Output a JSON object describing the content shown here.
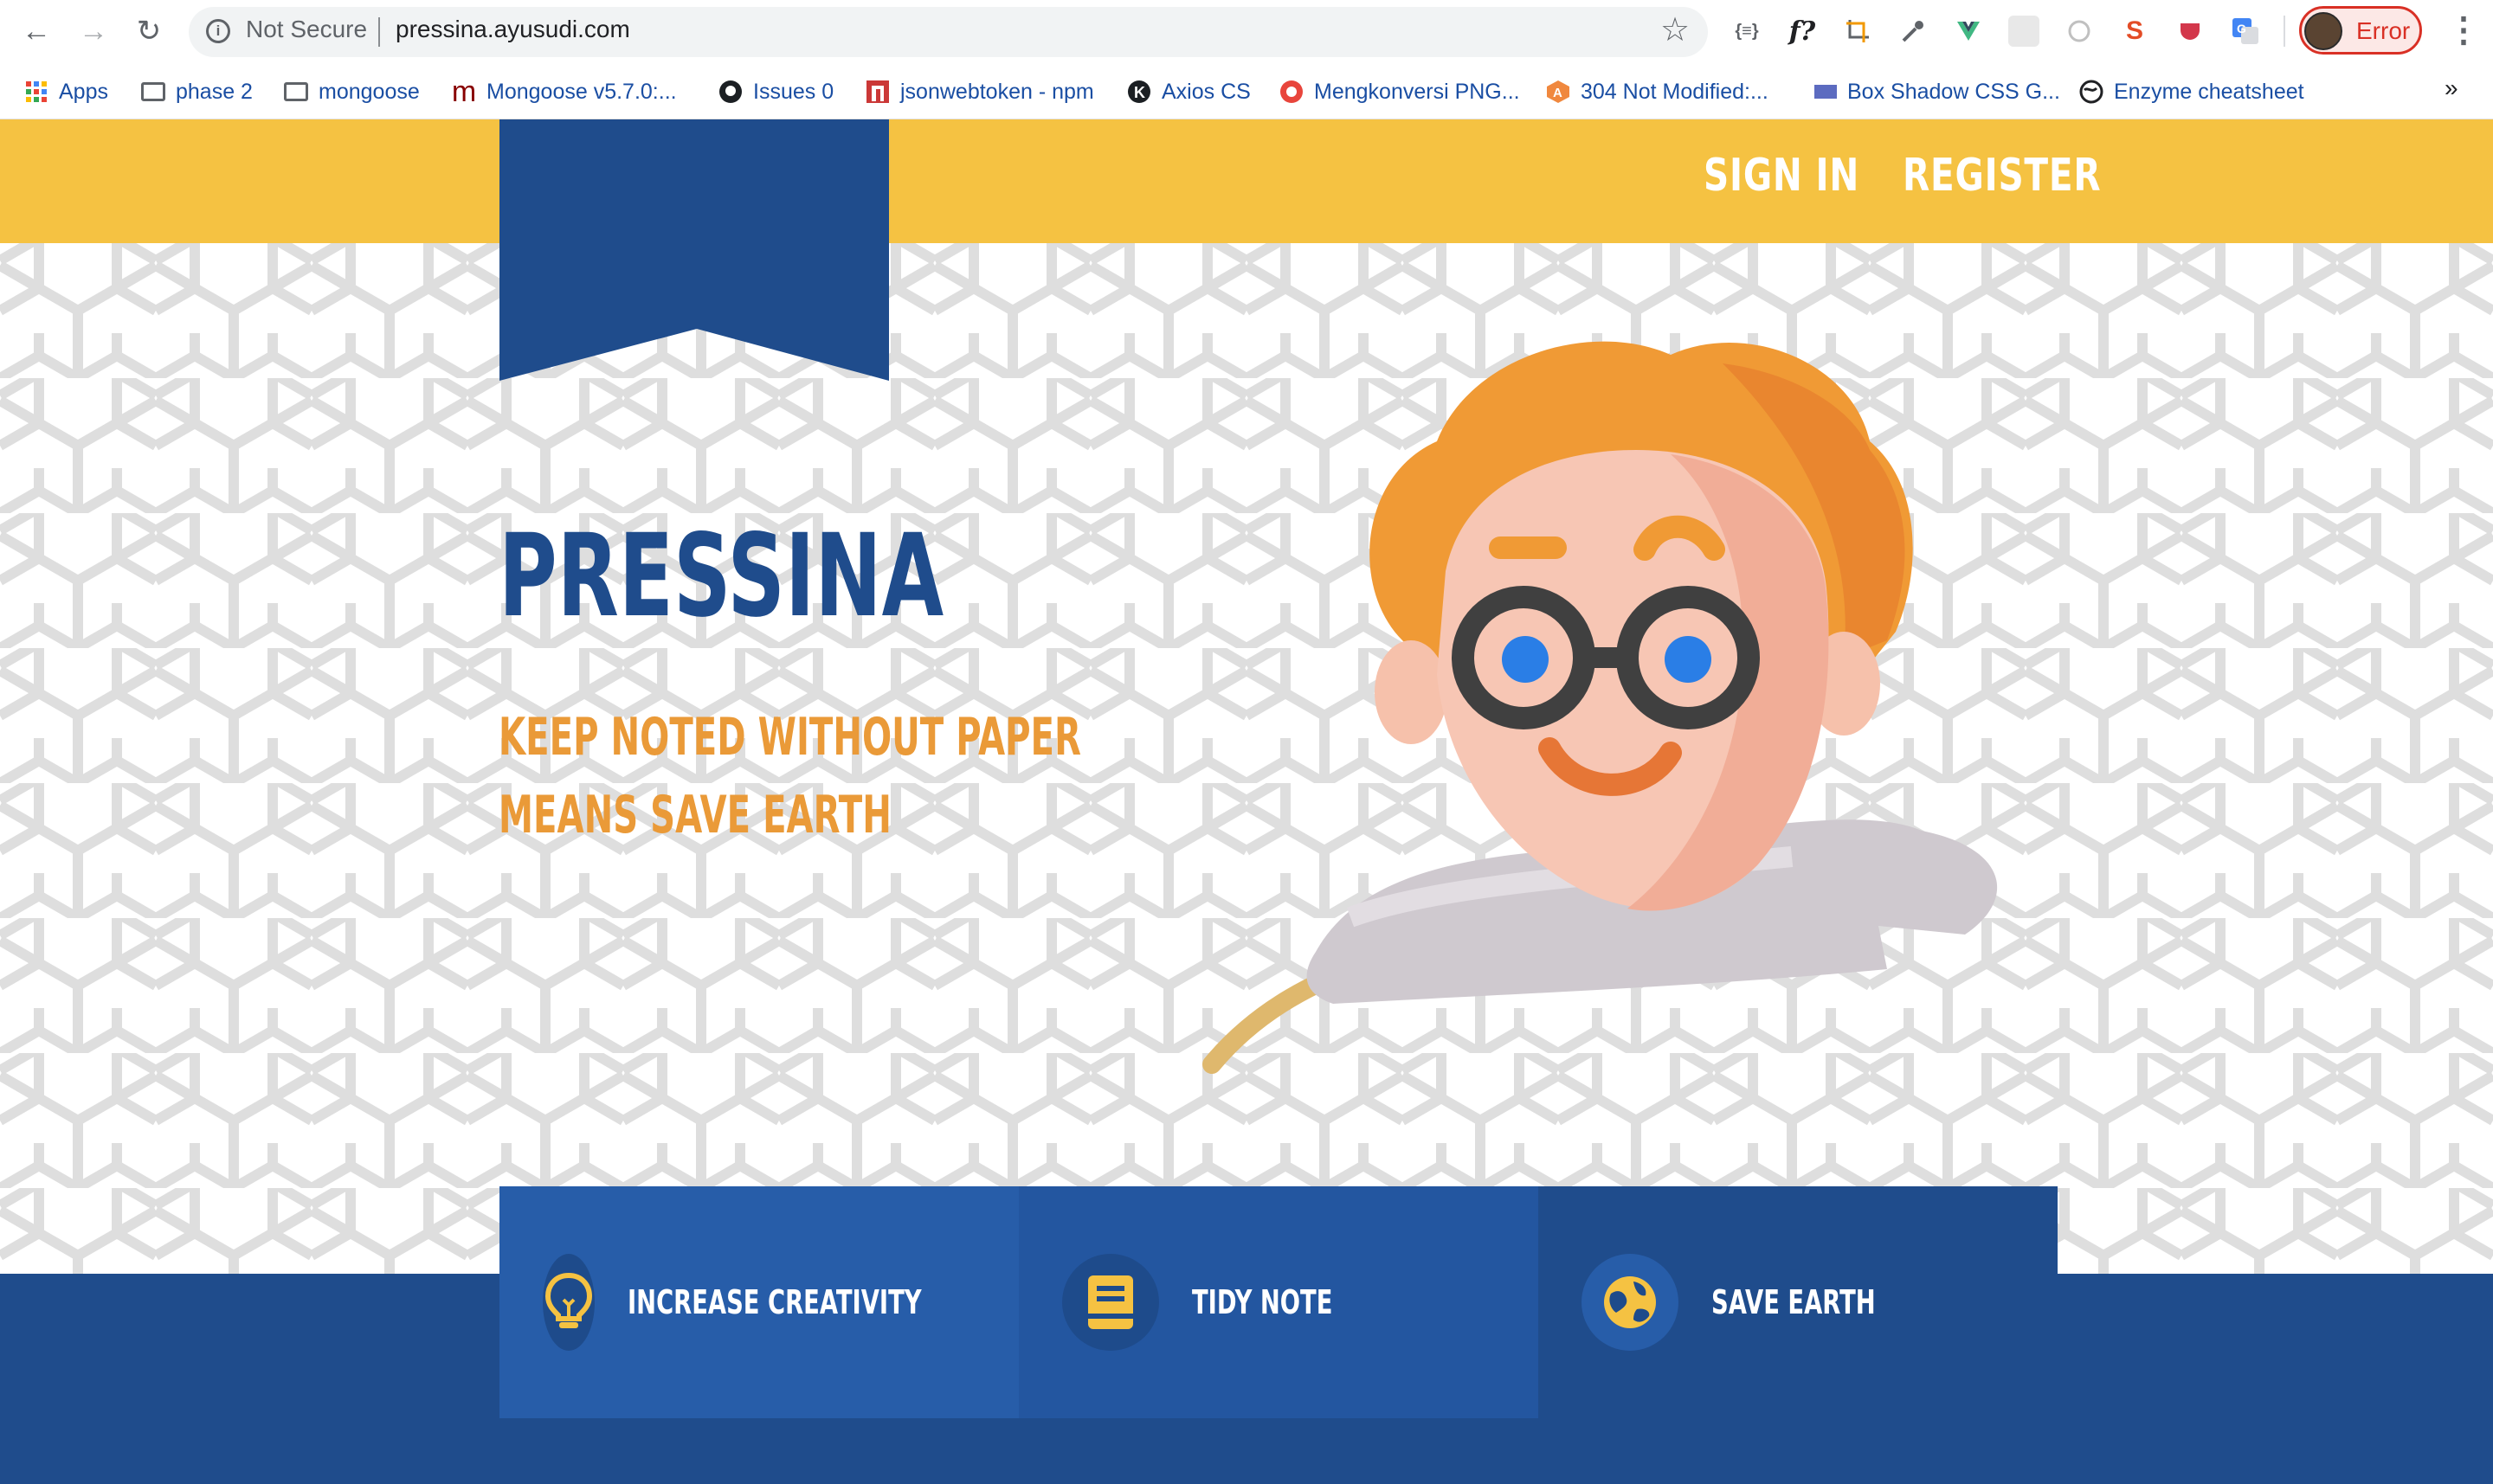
{
  "browser": {
    "security_label": "Not Secure",
    "url": "pressina.ayusudi.com",
    "profile_status": "Error",
    "bookmarks": [
      {
        "label": "Apps",
        "icon": "apps-grid-icon"
      },
      {
        "label": "phase 2",
        "icon": "folder-icon"
      },
      {
        "label": "mongoose",
        "icon": "folder-icon"
      },
      {
        "label": "Mongoose v5.7.0:...",
        "icon": "mongoose-icon"
      },
      {
        "label": "Issues 0",
        "icon": "github-icon"
      },
      {
        "label": "jsonwebtoken - npm",
        "icon": "npm-icon"
      },
      {
        "label": "Axios CS",
        "icon": "kk-icon"
      },
      {
        "label": "Mengkonversi PNG...",
        "icon": "converter-icon"
      },
      {
        "label": "304 Not Modified:...",
        "icon": "a-icon"
      },
      {
        "label": "Box Shadow CSS G...",
        "icon": "box-icon"
      },
      {
        "label": "Enzyme cheatsheet",
        "icon": "globe-icon"
      }
    ],
    "overflow_label": "»"
  },
  "header": {
    "nav": {
      "sign_in": "SIGN IN",
      "register": "REGISTER"
    }
  },
  "hero": {
    "brand": "PRESSINA",
    "tagline_line1": "KEEP NOTED WITHOUT PAPER",
    "tagline_line2": "MEANS SAVE EARTH"
  },
  "features": [
    {
      "label": "INCREASE CREATIVITY",
      "icon": "lightbulb-icon",
      "bg": "#275da9"
    },
    {
      "label": "TIDY NOTE",
      "icon": "book-icon",
      "bg": "#2356a0"
    },
    {
      "label": "SAVE EARTH",
      "icon": "globe-earth-icon",
      "bg": "#1f4c8c"
    }
  ],
  "colors": {
    "header_yellow": "#f5c242",
    "brand_blue": "#1f4c8c",
    "tagline_orange": "#ea9a38",
    "icon_yellow": "#f5c242"
  }
}
